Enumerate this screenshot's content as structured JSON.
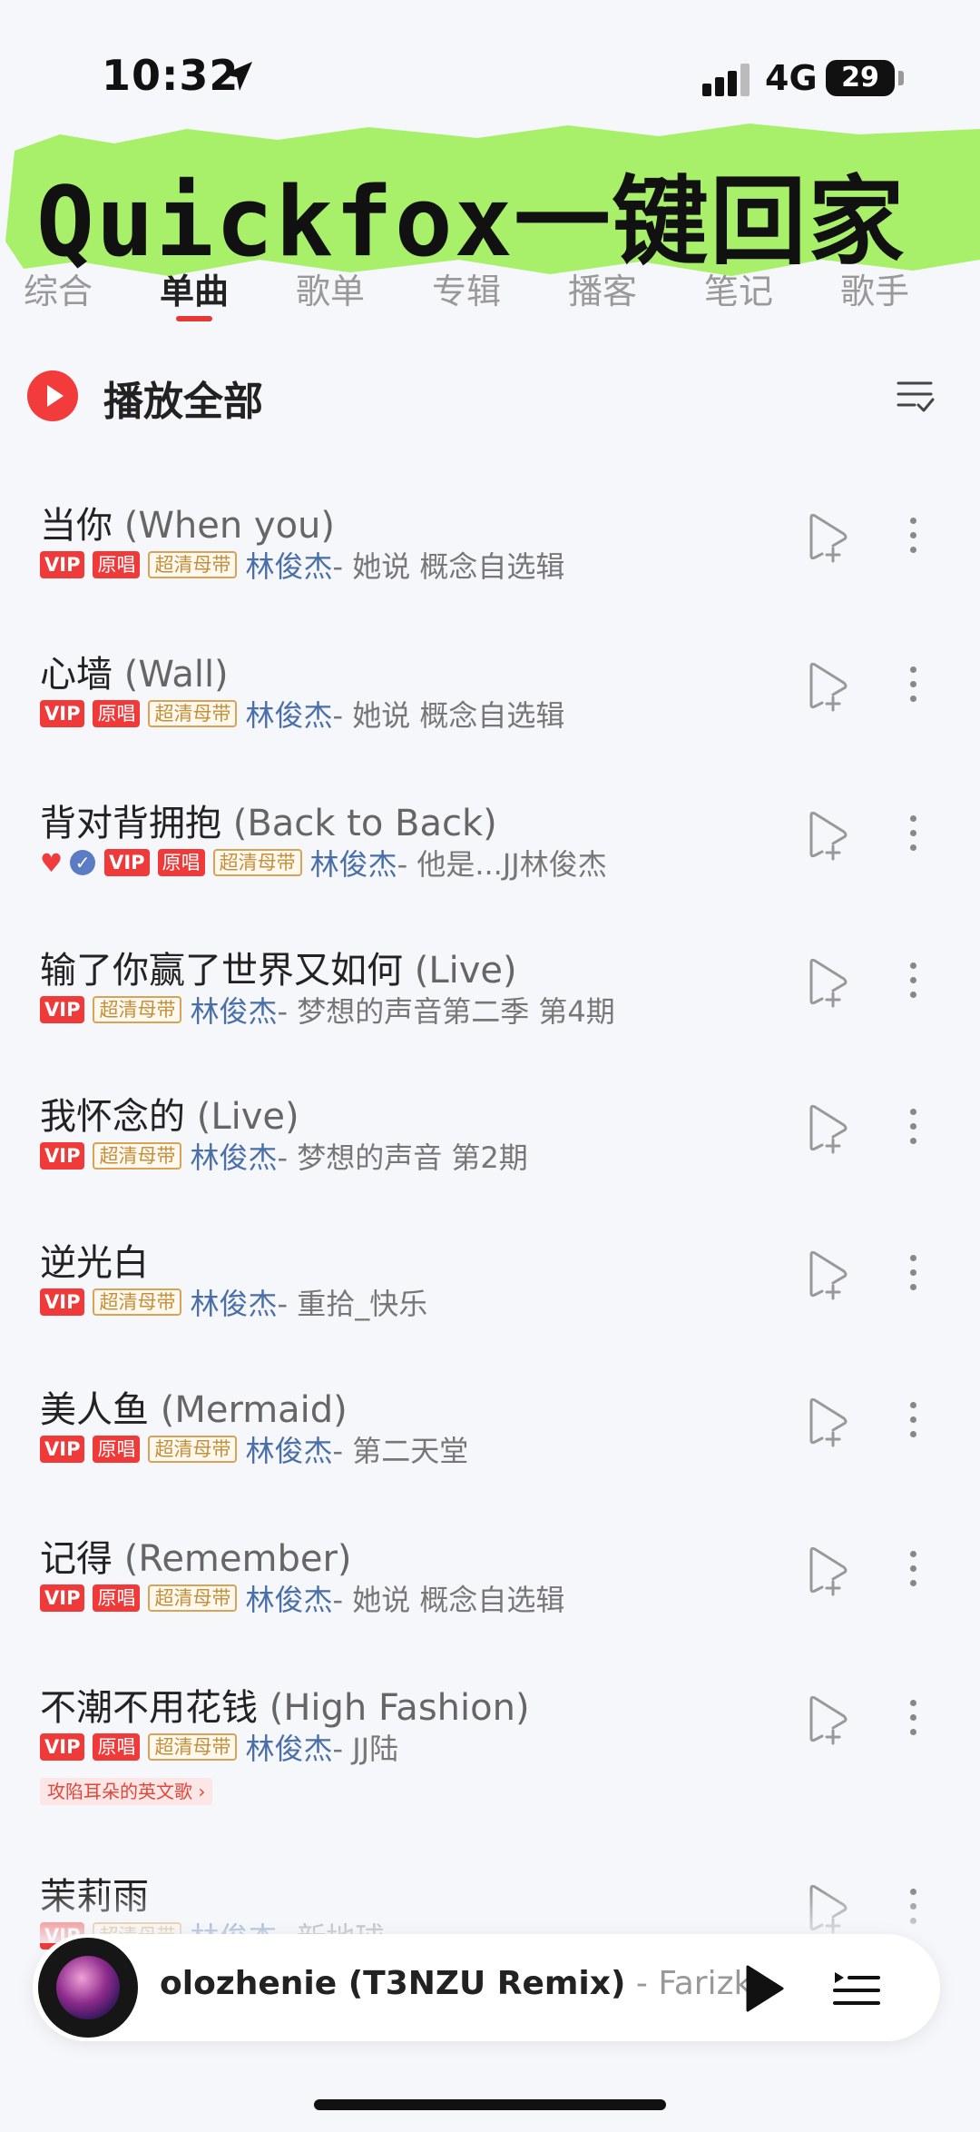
{
  "status_bar": {
    "time": "10:32",
    "network": "4G",
    "battery": "29"
  },
  "banner": {
    "text": "Quickfox一键回家"
  },
  "tabs": [
    "综合",
    "单曲",
    "歌单",
    "专辑",
    "播客",
    "笔记",
    "歌手"
  ],
  "play_all": {
    "label": "播放全部"
  },
  "songs": [
    {
      "title": "当你",
      "en": "(When you)",
      "tags": [
        "VIP",
        "原唱",
        "超清母带"
      ],
      "artist": "林俊杰",
      "album": " - 她说 概念自选辑"
    },
    {
      "title": "心墙",
      "en": "(Wall)",
      "tags": [
        "VIP",
        "原唱",
        "超清母带"
      ],
      "artist": "林俊杰",
      "album": " - 她说 概念自选辑"
    },
    {
      "title": "背对背拥抱",
      "en": "(Back to Back)",
      "tags": [
        "VIP",
        "原唱",
        "超清母带"
      ],
      "artist": "林俊杰",
      "album": " - 他是...JJ林俊杰"
    },
    {
      "title": "输了你赢了世界又如何",
      "en": "(Live)",
      "tags": [
        "VIP",
        "超清母带"
      ],
      "artist": "林俊杰",
      "album": " - 梦想的声音第二季 第4期"
    },
    {
      "title": "我怀念的",
      "en": "(Live)",
      "tags": [
        "VIP",
        "超清母带"
      ],
      "artist": "林俊杰",
      "album": " - 梦想的声音 第2期"
    },
    {
      "title": "逆光白",
      "en": "",
      "tags": [
        "VIP",
        "超清母带"
      ],
      "artist": "林俊杰",
      "album": " - 重拾_快乐"
    },
    {
      "title": "美人鱼",
      "en": "(Mermaid)",
      "tags": [
        "VIP",
        "原唱",
        "超清母带"
      ],
      "artist": "林俊杰",
      "album": " - 第二天堂"
    },
    {
      "title": "记得",
      "en": "(Remember)",
      "tags": [
        "VIP",
        "原唱",
        "超清母带"
      ],
      "artist": "林俊杰",
      "album": " - 她说 概念自选辑"
    },
    {
      "title": "不潮不用花钱",
      "en": "(High Fashion)",
      "tags": [
        "VIP",
        "原唱",
        "超清母带"
      ],
      "artist": "林俊杰",
      "album": " - JJ陆",
      "sub_tag": "攻陷耳朵的英文歌 ›"
    },
    {
      "title": "茉莉雨",
      "en": "",
      "tags": [
        "VIP",
        "超清母带"
      ],
      "artist": "林俊杰",
      "album": " - 新地球"
    }
  ],
  "player": {
    "song": "olozhenie (T3NZU Remix)",
    "artist": " - Farizki"
  },
  "icons": {
    "location": "location-arrow-icon",
    "signal": "signal-icon",
    "play_all": "play-icon",
    "sort": "sort-list-icon",
    "add": "add-to-playlist-icon",
    "more": "more-vertical-icon",
    "liked": "heart-icon",
    "verified": "check-icon",
    "player_play": "play-icon",
    "playlist": "playlist-icon"
  },
  "colors": {
    "accent": "#f23b3b",
    "artist": "#4a6fa8",
    "hq_tag": "#c48f3b",
    "banner_bg": "#a8f06a"
  }
}
